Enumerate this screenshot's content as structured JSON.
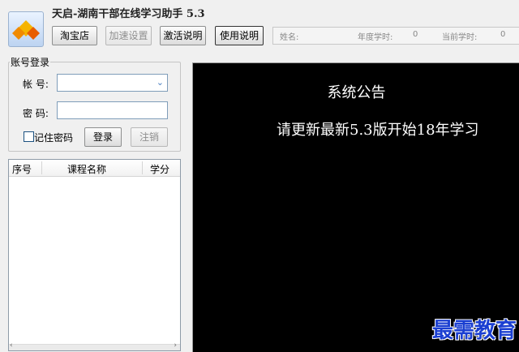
{
  "app": {
    "title": "天启-湖南干部在线学习助手 5.3"
  },
  "toolbar": {
    "taobao_label": "淘宝店",
    "speed_label": "加速设置",
    "activate_label": "激活说明",
    "usage_label": "使用说明"
  },
  "info": {
    "name_label": "姓名:",
    "annual_hours_label": "年度学时:",
    "annual_hours_value": "0",
    "current_hours_label": "当前学时:",
    "current_hours_value": "0"
  },
  "login": {
    "group_title": "账号登录",
    "account_label": "帐  号:",
    "password_label": "密  码:",
    "remember_label": "记住密码",
    "login_label": "登录",
    "logout_label": "注销"
  },
  "course_list": {
    "columns": [
      "序号",
      "课程名称",
      "学分"
    ]
  },
  "notice": {
    "title": "系统公告",
    "body": "请更新最新5.3版开始18年学习"
  },
  "watermark": {
    "text": "最需教育"
  },
  "colors": {
    "notice_bg": "#000000",
    "watermark": "#1b3fd1"
  }
}
